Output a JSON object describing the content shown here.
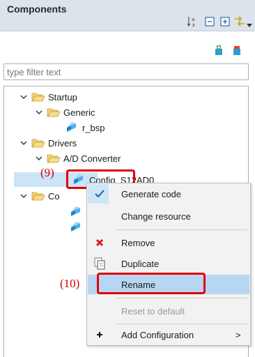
{
  "header": {
    "title": "Components"
  },
  "filter": {
    "placeholder": "type filter text"
  },
  "tree": {
    "startup": "Startup",
    "generic": "Generic",
    "r_bsp": "r_bsp",
    "drivers": "Drivers",
    "ad_converter": "A/D Converter",
    "config_s12ad0": "Config_S12AD0",
    "co_partial": "Co"
  },
  "annotations": {
    "step9": "(9)",
    "step10": "(10)"
  },
  "context_menu": {
    "items": [
      "Generate code",
      "Change resource",
      "Remove",
      "Duplicate",
      "Rename",
      "Reset to default",
      "Add Configuration"
    ],
    "submenu_arrow": ">"
  },
  "colors": {
    "highlight": "#cce4f7",
    "annotation_red": "#e00000",
    "folder": "#e8b94a"
  },
  "icons": [
    "sort-alpha-icon",
    "collapse-all-icon",
    "expand-all-icon",
    "link-editor-icon",
    "view-menu-icon",
    "add-component-icon",
    "remove-component-icon",
    "chevron-down-icon",
    "folder-open-icon",
    "component-icon",
    "check-icon",
    "remove-x-icon",
    "duplicate-icon",
    "plus-icon",
    "submenu-arrow-icon"
  ]
}
